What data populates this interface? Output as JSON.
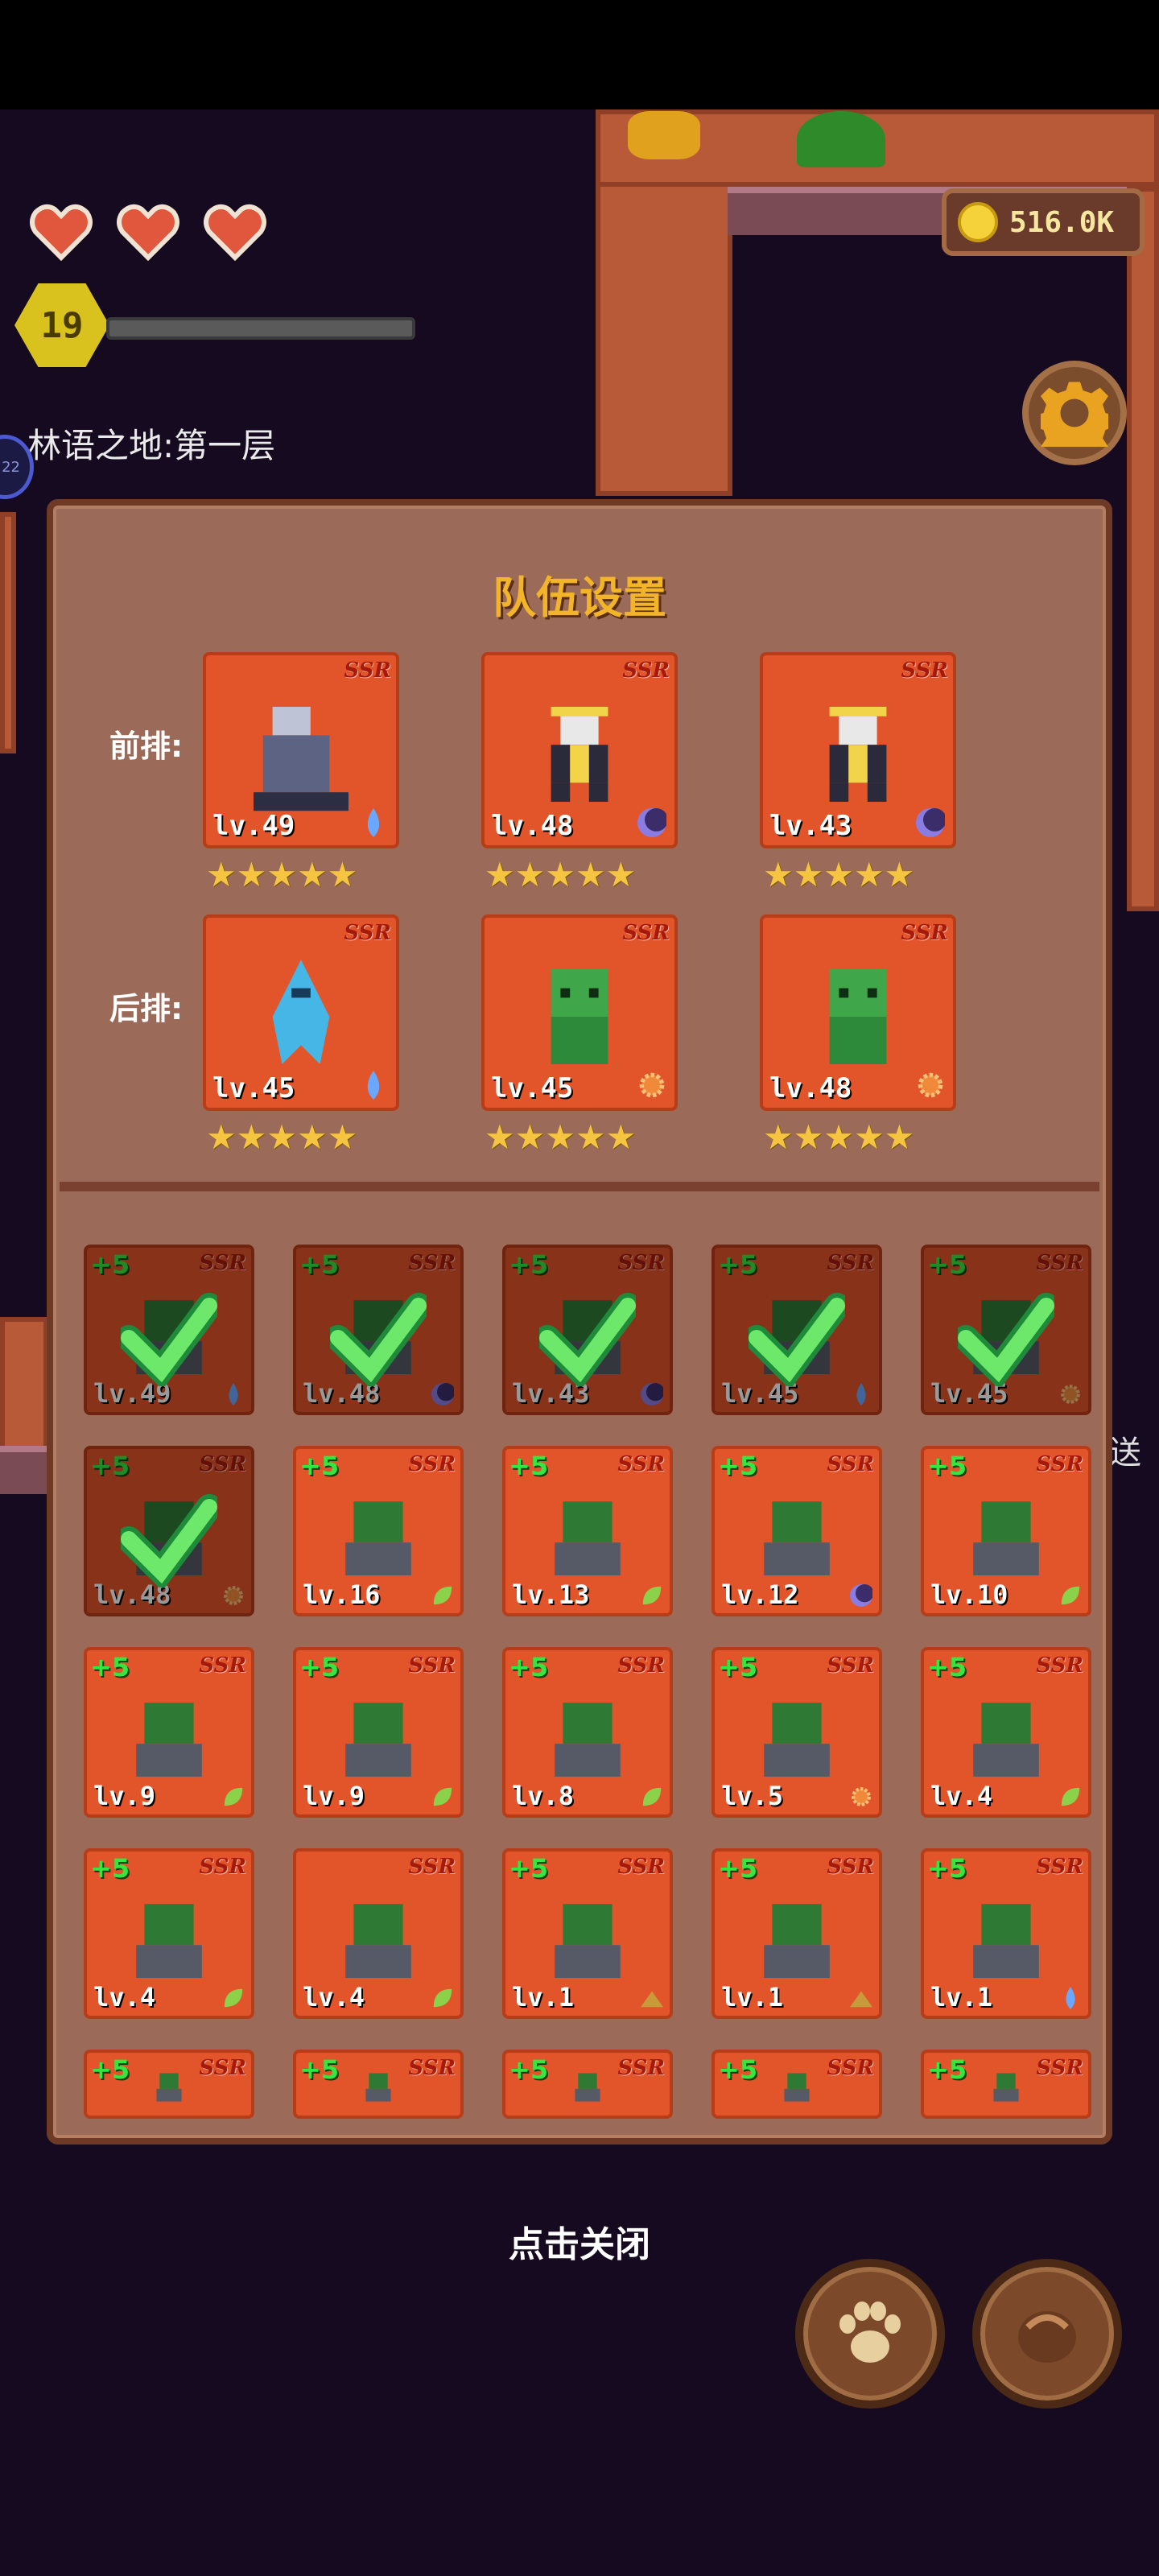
{
  "hud": {
    "hearts": [
      "heart",
      "heart",
      "heart"
    ],
    "level": "19",
    "xp_fraction": 0.0,
    "area_name": "林语之地:第一层",
    "side_badge": "22",
    "coins": "516.0K",
    "side_text": "送"
  },
  "panel": {
    "title": "队伍设置",
    "front_label": "前排:",
    "back_label": "后排:",
    "front_row": [
      {
        "level": "lv.49",
        "rarity": "SSR",
        "stars": "★★★★★",
        "element": "water-icon",
        "sprite": "grey-mage-icon"
      },
      {
        "level": "lv.48",
        "rarity": "SSR",
        "stars": "★★★★★",
        "element": "moon-icon",
        "sprite": "armored-knight-icon"
      },
      {
        "level": "lv.43",
        "rarity": "SSR",
        "stars": "★★★★★",
        "element": "moon-icon",
        "sprite": "armored-knight-icon"
      }
    ],
    "back_row": [
      {
        "level": "lv.45",
        "rarity": "SSR",
        "stars": "★★★★★",
        "element": "water-icon",
        "sprite": "water-spirit-icon"
      },
      {
        "level": "lv.45",
        "rarity": "SSR",
        "stars": "★★★★★",
        "element": "sun-icon",
        "sprite": "green-goblin-icon"
      },
      {
        "level": "lv.48",
        "rarity": "SSR",
        "stars": "★★★★★",
        "element": "sun-icon",
        "sprite": "green-goblin-icon"
      }
    ],
    "roster": [
      {
        "plus": "+5",
        "rarity": "SSR",
        "level": "lv.49",
        "element": "water-icon",
        "selected": true
      },
      {
        "plus": "+5",
        "rarity": "SSR",
        "level": "lv.48",
        "element": "moon-icon",
        "selected": true
      },
      {
        "plus": "+5",
        "rarity": "SSR",
        "level": "lv.43",
        "element": "moon-icon",
        "selected": true
      },
      {
        "plus": "+5",
        "rarity": "SSR",
        "level": "lv.45",
        "element": "water-icon",
        "selected": true
      },
      {
        "plus": "+5",
        "rarity": "SSR",
        "level": "lv.45",
        "element": "sun-icon",
        "selected": true
      },
      {
        "plus": "+5",
        "rarity": "SSR",
        "level": "lv.48",
        "element": "sun-icon",
        "selected": true
      },
      {
        "plus": "+5",
        "rarity": "SSR",
        "level": "lv.16",
        "element": "leaf-icon",
        "selected": false
      },
      {
        "plus": "+5",
        "rarity": "SSR",
        "level": "lv.13",
        "element": "leaf-icon",
        "selected": false
      },
      {
        "plus": "+5",
        "rarity": "SSR",
        "level": "lv.12",
        "element": "moon-icon",
        "selected": false
      },
      {
        "plus": "+5",
        "rarity": "SSR",
        "level": "lv.10",
        "element": "leaf-icon",
        "selected": false
      },
      {
        "plus": "+5",
        "rarity": "SSR",
        "level": "lv.9",
        "element": "leaf-icon",
        "selected": false
      },
      {
        "plus": "+5",
        "rarity": "SSR",
        "level": "lv.9",
        "element": "leaf-icon",
        "selected": false
      },
      {
        "plus": "+5",
        "rarity": "SSR",
        "level": "lv.8",
        "element": "leaf-icon",
        "selected": false
      },
      {
        "plus": "+5",
        "rarity": "SSR",
        "level": "lv.5",
        "element": "sun-icon",
        "selected": false
      },
      {
        "plus": "+5",
        "rarity": "SSR",
        "level": "lv.4",
        "element": "leaf-icon",
        "selected": false
      },
      {
        "plus": "+5",
        "rarity": "SSR",
        "level": "lv.4",
        "element": "leaf-icon",
        "selected": false
      },
      {
        "plus": "",
        "rarity": "SSR",
        "level": "lv.4",
        "element": "leaf-icon",
        "selected": false
      },
      {
        "plus": "+5",
        "rarity": "SSR",
        "level": "lv.1",
        "element": "earth-icon",
        "selected": false
      },
      {
        "plus": "+5",
        "rarity": "SSR",
        "level": "lv.1",
        "element": "earth-icon",
        "selected": false
      },
      {
        "plus": "+5",
        "rarity": "SSR",
        "level": "lv.1",
        "element": "water-icon",
        "selected": false
      },
      {
        "plus": "+5",
        "rarity": "SSR",
        "level": "",
        "element": "",
        "selected": false
      },
      {
        "plus": "+5",
        "rarity": "SSR",
        "level": "",
        "element": "",
        "selected": false
      },
      {
        "plus": "+5",
        "rarity": "SSR",
        "level": "",
        "element": "",
        "selected": false
      },
      {
        "plus": "+5",
        "rarity": "SSR",
        "level": "",
        "element": "",
        "selected": false
      },
      {
        "plus": "+5",
        "rarity": "SSR",
        "level": "",
        "element": "",
        "selected": false
      }
    ]
  },
  "footer": {
    "close_text": "点击关闭",
    "pet_button": "paw-icon",
    "bag_button": "bag-icon"
  },
  "colors": {
    "card_bg": "#e2542a",
    "panel_bg": "#9c6a58",
    "title": "#f2b429",
    "plus_green": "#33e640",
    "star_gold": "#f5c542"
  }
}
